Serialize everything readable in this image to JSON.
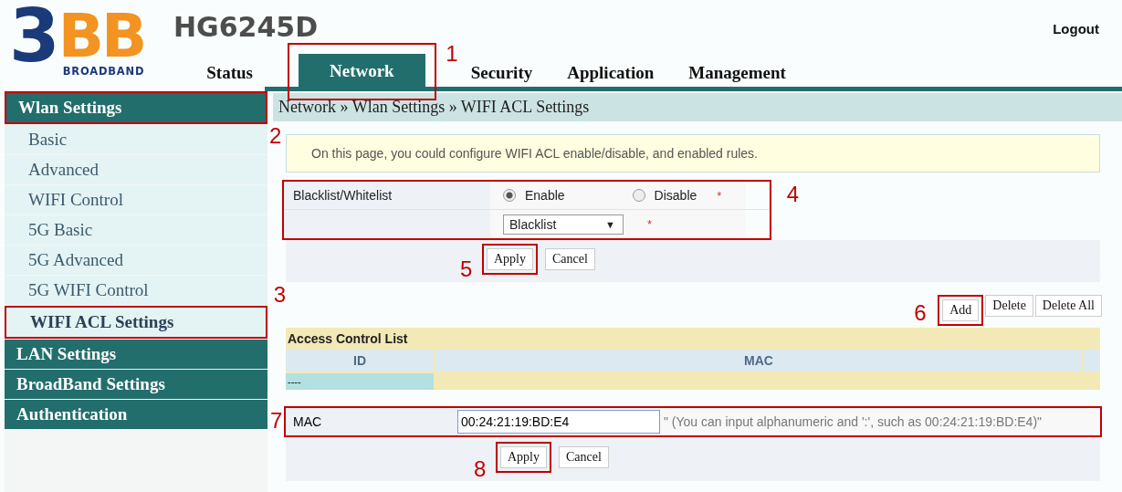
{
  "header": {
    "logo_numeral": "3",
    "logo_letters": "BB",
    "logo_tagline": "BROADBAND",
    "model": "HG6245D",
    "logout": "Logout"
  },
  "tabs": [
    {
      "label": "Status",
      "selected": false
    },
    {
      "label": "Network",
      "selected": true,
      "highlighted": true,
      "callout": "1"
    },
    {
      "label": "Security",
      "selected": false
    },
    {
      "label": "Application",
      "selected": false
    },
    {
      "label": "Management",
      "selected": false
    }
  ],
  "sidebar": [
    {
      "label": "Wlan Settings",
      "highlighted": true,
      "items": [
        {
          "label": "Basic",
          "selected": false
        },
        {
          "label": "Advanced",
          "selected": false
        },
        {
          "label": "WIFI Control",
          "selected": false
        },
        {
          "label": "5G Basic",
          "selected": false
        },
        {
          "label": "5G Advanced",
          "selected": false
        },
        {
          "label": "5G WIFI Control",
          "selected": false
        },
        {
          "label": "WIFI ACL Settings",
          "selected": true,
          "highlighted": true,
          "callout": "3"
        }
      ]
    },
    {
      "label": "LAN Settings"
    },
    {
      "label": "BroadBand Settings"
    },
    {
      "label": "Authentication"
    }
  ],
  "breadcrumb": "Network » Wlan Settings » WIFI ACL Settings",
  "info": {
    "text": "On this page, you could configure WIFI ACL enable/disable, and enabled rules.",
    "callout": "2"
  },
  "acl_form": {
    "highlighted": true,
    "callout": "4",
    "label": "Blacklist/Whitelist",
    "required_mark": "*",
    "options": [
      {
        "label": "Enable",
        "selected": true
      },
      {
        "label": "Disable",
        "selected": false
      }
    ],
    "mode": {
      "value": "Blacklist",
      "caret": "▼",
      "required_mark": "*"
    }
  },
  "form_buttons": [
    {
      "label": "Apply",
      "highlighted": true,
      "callout": "5"
    },
    {
      "label": "Cancel"
    }
  ],
  "list_buttons": [
    {
      "label": "Add",
      "highlighted": true,
      "callout": "6"
    },
    {
      "label": "Delete"
    },
    {
      "label": "Delete All"
    }
  ],
  "acl_table": {
    "title": "Access Control List",
    "columns": [
      "ID",
      "MAC"
    ],
    "rows": [
      {
        "id": "----"
      }
    ]
  },
  "mac_form": {
    "label": "MAC",
    "value": "00:24:21:19:BD:E4",
    "hint": "\" (You can input alphanumeric and ':', such as 00:24:21:19:BD:E4)\"",
    "highlighted": true,
    "callout": "7"
  },
  "mac_buttons": [
    {
      "label": "Apply",
      "highlighted": true,
      "callout": "8"
    },
    {
      "label": "Cancel"
    }
  ]
}
